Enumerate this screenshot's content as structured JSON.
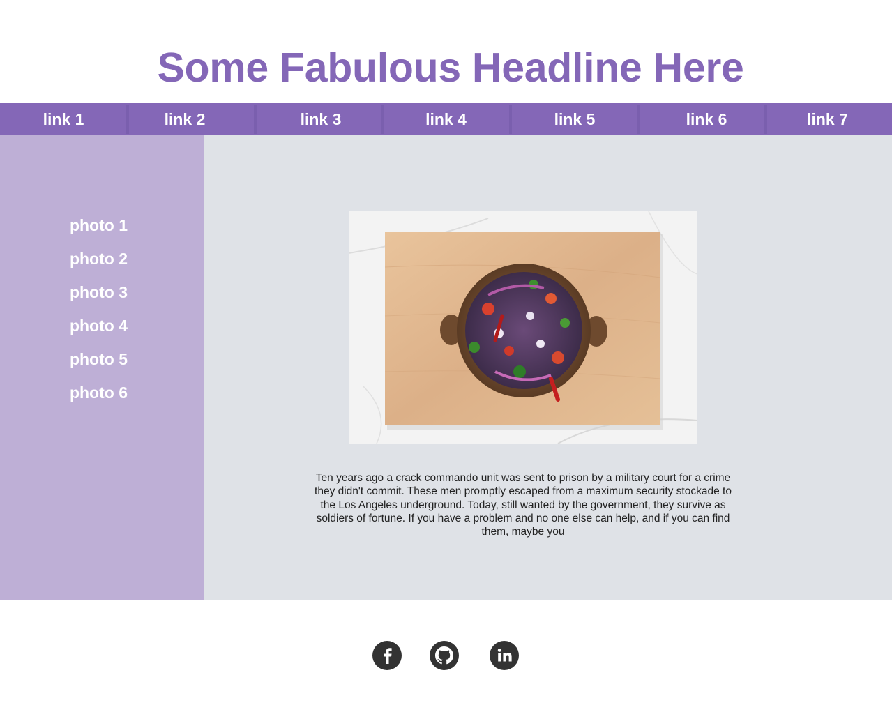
{
  "header": {
    "headline": "Some Fabulous Headline Here"
  },
  "nav": {
    "links": [
      {
        "label": "link 1"
      },
      {
        "label": "link 2"
      },
      {
        "label": "link 3"
      },
      {
        "label": "link 4"
      },
      {
        "label": "link 5"
      },
      {
        "label": "link 6"
      },
      {
        "label": "link 7"
      }
    ]
  },
  "sidebar": {
    "items": [
      {
        "label": "photo 1"
      },
      {
        "label": "photo 2"
      },
      {
        "label": "photo 3"
      },
      {
        "label": "photo 4"
      },
      {
        "label": "photo 5"
      },
      {
        "label": "photo 6"
      }
    ]
  },
  "main": {
    "caption": "Ten years ago a crack commando unit was sent to prison by a military court for a crime they didn't commit. These men promptly escaped from a maximum security stockade to the Los Angeles underground. Today, still wanted by the government, they survive as soldiers of fortune. If you have a problem and no one else can help, and if you can find them, maybe you"
  },
  "footer": {
    "social_icons": [
      "facebook-icon",
      "github-icon",
      "linkedin-icon"
    ]
  },
  "colors": {
    "accent": "#8467b7",
    "sidebar_bg": "#beafd6",
    "main_bg": "#dfe2e7",
    "icon": "#333333"
  }
}
